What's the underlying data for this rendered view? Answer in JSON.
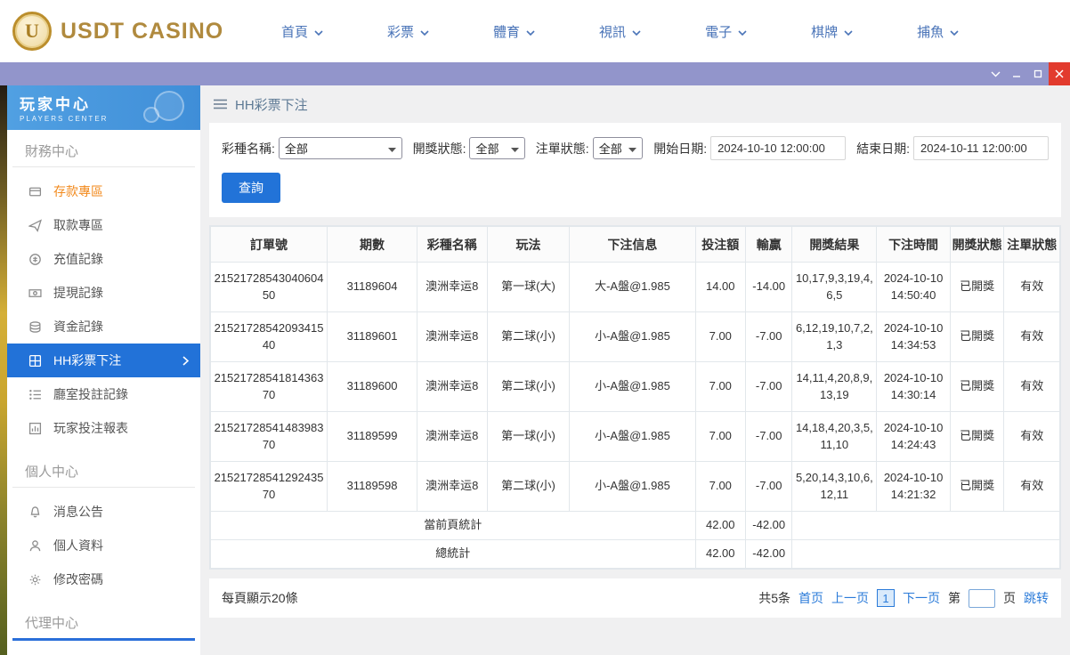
{
  "colors": {
    "accent_blue": "#2272d8",
    "link_blue": "#2b7bd9",
    "highlight_orange": "#f28a1d",
    "titlebar_purple": "#9295cb",
    "close_red": "#e23b2e",
    "logo_gold": "#b08a3e",
    "sidebar_header_blue": "#3f8ed8"
  },
  "header": {
    "logo_letter": "U",
    "logo_text": "USDT CASINO",
    "nav_items": [
      "首頁",
      "彩票",
      "體育",
      "視訊",
      "電子",
      "棋牌",
      "捕魚"
    ]
  },
  "window_controls": [
    "chevron-down",
    "minimize",
    "maximize",
    "close"
  ],
  "sidebar": {
    "title": "玩家中心",
    "subtitle": "PLAYERS CENTER",
    "sections": [
      {
        "label": "財務中心",
        "items": [
          {
            "label": "存款專區",
            "icon": "deposit",
            "highlight": true
          },
          {
            "label": "取款專區",
            "icon": "withdraw"
          },
          {
            "label": "充值記錄",
            "icon": "recharge"
          },
          {
            "label": "提現記錄",
            "icon": "cashout"
          },
          {
            "label": "資金記錄",
            "icon": "funds"
          },
          {
            "label": "HH彩票下注",
            "icon": "lottery",
            "active": true
          },
          {
            "label": "廳室投註記錄",
            "icon": "hall"
          },
          {
            "label": "玩家投注報表",
            "icon": "report"
          }
        ]
      },
      {
        "label": "個人中心",
        "items": [
          {
            "label": "消息公告",
            "icon": "bell"
          },
          {
            "label": "個人資料",
            "icon": "person"
          },
          {
            "label": "修改密碼",
            "icon": "gear"
          }
        ]
      },
      {
        "label": "代理中心",
        "accent": true,
        "items": []
      }
    ]
  },
  "breadcrumb": {
    "title": "HH彩票下注"
  },
  "filters": {
    "lottery_label": "彩種名稱:",
    "lottery_value": "全部",
    "draw_label": "開獎狀態:",
    "draw_value": "全部",
    "order_label": "注單狀態:",
    "order_value": "全部",
    "start_label": "開始日期:",
    "start_value": "2024-10-10 12:00:00",
    "end_label": "結束日期:",
    "end_value": "2024-10-11 12:00:00",
    "query_button": "查詢"
  },
  "table": {
    "headers": [
      "訂單號",
      "期數",
      "彩種名稱",
      "玩法",
      "下注信息",
      "投注額",
      "輸贏",
      "開獎結果",
      "下注時間",
      "開獎狀態",
      "注單狀態"
    ],
    "rows": [
      [
        "2152172854304060450",
        "31189604",
        "澳洲幸运8",
        "第一球(大)",
        "大-A盤@1.985",
        "14.00",
        "-14.00",
        "10,17,9,3,19,4,6,5",
        "2024-10-10 14:50:40",
        "已開獎",
        "有效"
      ],
      [
        "2152172854209341540",
        "31189601",
        "澳洲幸运8",
        "第二球(小)",
        "小-A盤@1.985",
        "7.00",
        "-7.00",
        "6,12,19,10,7,2,1,3",
        "2024-10-10 14:34:53",
        "已開獎",
        "有效"
      ],
      [
        "2152172854181436370",
        "31189600",
        "澳洲幸运8",
        "第二球(小)",
        "小-A盤@1.985",
        "7.00",
        "-7.00",
        "14,11,4,20,8,9,13,19",
        "2024-10-10 14:30:14",
        "已開獎",
        "有效"
      ],
      [
        "2152172854148398370",
        "31189599",
        "澳洲幸运8",
        "第一球(小)",
        "小-A盤@1.985",
        "7.00",
        "-7.00",
        "14,18,4,20,3,5,11,10",
        "2024-10-10 14:24:43",
        "已開獎",
        "有效"
      ],
      [
        "2152172854129243570",
        "31189598",
        "澳洲幸运8",
        "第二球(小)",
        "小-A盤@1.985",
        "7.00",
        "-7.00",
        "5,20,14,3,10,6,12,11",
        "2024-10-10 14:21:32",
        "已開獎",
        "有效"
      ]
    ],
    "summary": [
      {
        "label": "當前頁統計",
        "bet": "42.00",
        "winloss": "-42.00"
      },
      {
        "label": "總統計",
        "bet": "42.00",
        "winloss": "-42.00"
      }
    ]
  },
  "pagination": {
    "page_size_text": "每頁顯示20條",
    "total_text": "共5条",
    "first": "首页",
    "prev": "上一页",
    "current": "1",
    "next": "下一页",
    "goto_prefix": "第",
    "goto_suffix": "页",
    "jump": "跳转"
  }
}
